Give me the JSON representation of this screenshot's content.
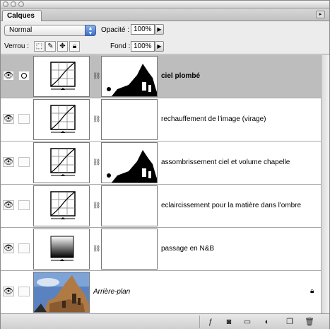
{
  "panel": {
    "tab_label": "Calques",
    "menu_arrow": "▸"
  },
  "blend": {
    "mode": "Normal",
    "opacity_label": "Opacité :",
    "opacity_value": "100%",
    "lock_label": "Verrou :",
    "fill_label": "Fond :",
    "fill_value": "100%"
  },
  "lock_icons": [
    "lock-transparency-icon",
    "lock-brush-icon",
    "lock-move-icon",
    "lock-all-icon"
  ],
  "layers": [
    {
      "name": "ciel plombé",
      "selected": true,
      "bold": true,
      "mask": "dark",
      "thumb": "curves"
    },
    {
      "name": "rechauffement de l'image (virage)",
      "selected": false,
      "bold": false,
      "mask": "white",
      "thumb": "curves"
    },
    {
      "name": "assombrissement ciel et volume chapelle",
      "selected": false,
      "bold": false,
      "mask": "dark",
      "thumb": "curves"
    },
    {
      "name": "eclaircissement pour la matière dans l'ombre",
      "selected": false,
      "bold": false,
      "mask": "white",
      "thumb": "curves"
    },
    {
      "name": "passage en N&B",
      "selected": false,
      "bold": false,
      "mask": "white",
      "thumb": "gradient"
    },
    {
      "name": "Arrière-plan",
      "selected": false,
      "bold": false,
      "italic": true,
      "mask": "none",
      "thumb": "photo"
    }
  ],
  "bottom_icons": [
    "layer-style-icon",
    "add-mask-icon",
    "new-group-icon",
    "adjustment-layer-icon",
    "new-layer-icon",
    "trash-icon"
  ]
}
